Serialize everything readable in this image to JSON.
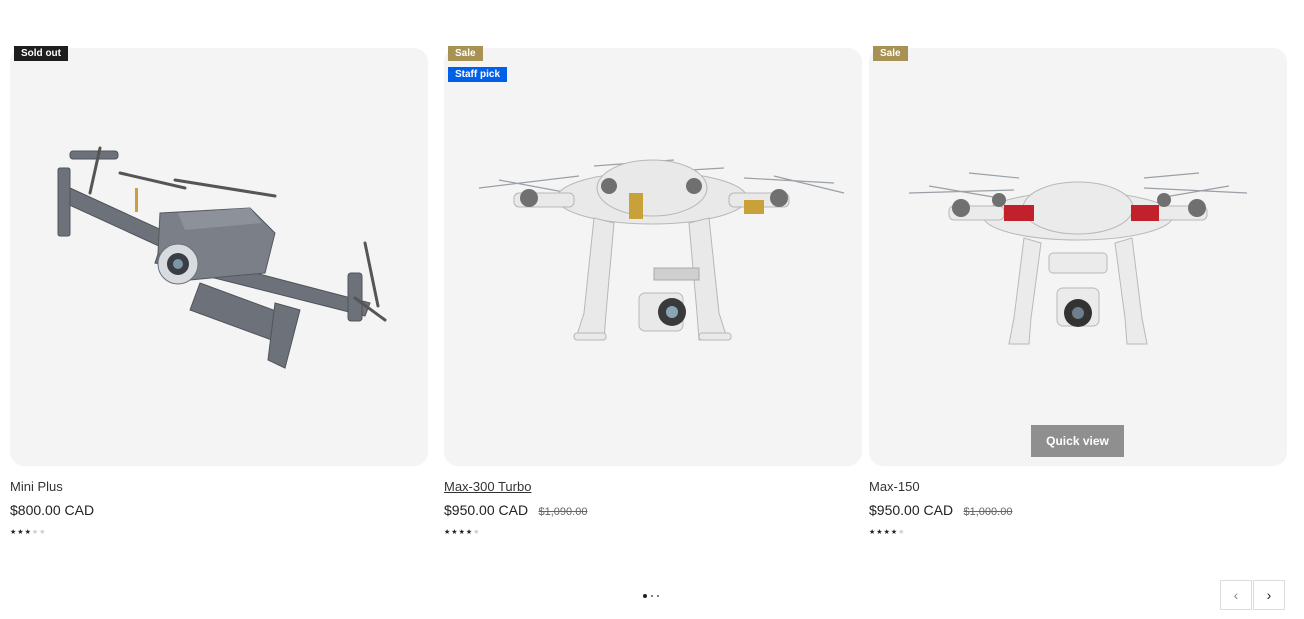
{
  "products": [
    {
      "badges": [
        "Sold out"
      ],
      "title": "Mini Plus",
      "price": "$800.00 CAD",
      "compare_price": "",
      "rating": 2.5,
      "image": "grey-foldable-drone"
    },
    {
      "badges": [
        "Sale",
        "Staff pick"
      ],
      "title": "Max-300 Turbo",
      "price": "$950.00 CAD",
      "compare_price": "$1,090.00",
      "rating": 4,
      "image": "white-quadcopter-gold-stripes"
    },
    {
      "badges": [
        "Sale"
      ],
      "title": "Max-150",
      "price": "$950.00 CAD",
      "compare_price": "$1,000.00",
      "rating": 4,
      "image": "white-quadcopter-red-stripes",
      "quick_view_label": "Quick view"
    }
  ],
  "carousel": {
    "total_pages": 3,
    "current_page": 1,
    "prev_icon": "chevron-left-icon",
    "next_icon": "chevron-right-icon",
    "prev_glyph": "‹",
    "next_glyph": "›"
  },
  "colors": {
    "sold_out_badge": "#1e1e1e",
    "sale_badge": "#a79253",
    "staff_pick_badge": "#0061e8",
    "media_background": "#f4f4f4",
    "quick_view_button": "#8f8f8f"
  }
}
